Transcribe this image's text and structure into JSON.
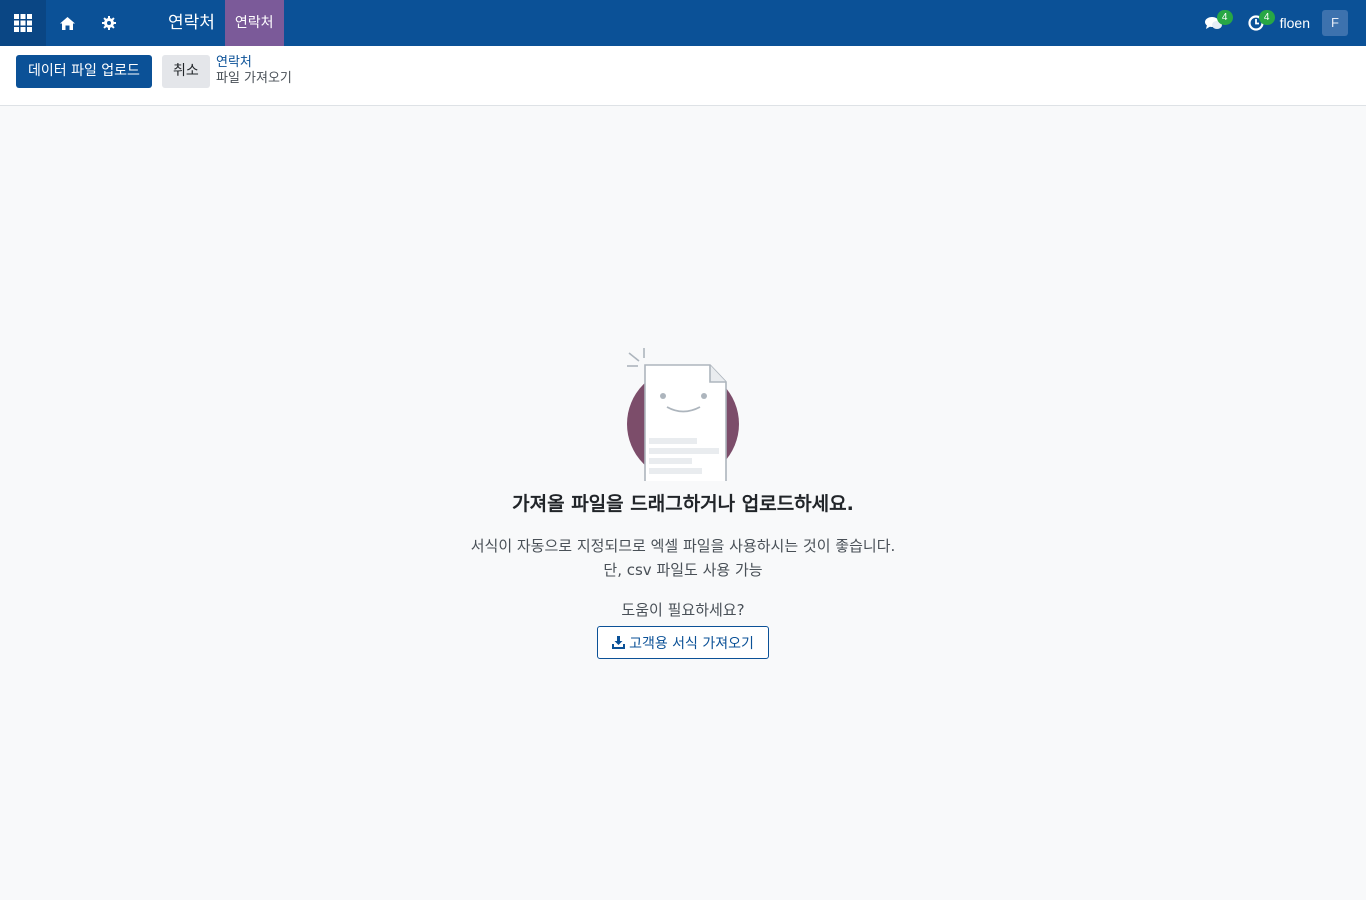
{
  "navbar": {
    "apps_icon": "apps-grid-icon",
    "home_icon": "home-icon",
    "settings_icon": "gear-icon",
    "app_title": "연락처",
    "menu_active": "연락처",
    "messages_count": "4",
    "activities_count": "4",
    "username": "floen",
    "avatar_letter": "F",
    "colors": {
      "bar": "#0b5197",
      "menu_active": "#7b5a99",
      "badge": "#28a745"
    }
  },
  "control_panel": {
    "upload_button": "데이터 파일 업로드",
    "cancel_button": "취소",
    "breadcrumb": {
      "parent": "연락처",
      "current": "파일 가져오기"
    }
  },
  "main": {
    "headline": "가져올 파일을 드래그하거나 업로드하세요.",
    "description_line1": "서식이 자동으로 지정되므로 엑셀 파일을 사용하시는 것이 좋습니다.",
    "description_line2": "단, csv 파일도 사용 가능",
    "help_text": "도움이 필요하세요?",
    "template_button": "고객용 서식 가져오기",
    "template_icon": "download-icon"
  }
}
